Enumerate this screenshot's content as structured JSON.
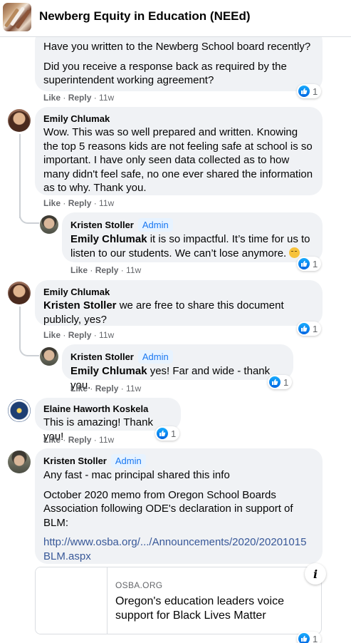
{
  "header": {
    "group_name": "Newberg Equity in Education (NEEd)"
  },
  "common": {
    "like": "Like",
    "reply": "Reply",
    "sep": " · ",
    "admin": "Admin"
  },
  "c1": {
    "para1": "Have you written to the Newberg School board recently?",
    "para2": "Did you receive a response back as required by the superintendent working agreement?",
    "time": "11w",
    "reactions": "1"
  },
  "c2": {
    "author": "Emily Chlumak",
    "text": "Wow. This was so well prepared and written. Knowing the top 5 reasons kids are not feeling safe at school is so important. I have only seen data collected as to how many didn't feel safe, no one ever shared the information as to why. Thank you.",
    "time": "11w"
  },
  "r1": {
    "author": "Kristen Stoller",
    "mention": "Emily Chlumak",
    "text": " it is so impactful. It’s time for us to listen to our students. We can’t lose anymore. ",
    "emoji": "disappointed-face",
    "time": "11w",
    "reactions": "1"
  },
  "c3": {
    "author": "Emily Chlumak",
    "mention": "Kristen Stoller",
    "text": " we are free to share this document publicly, yes?",
    "time": "11w",
    "reactions": "1"
  },
  "r2": {
    "author": "Kristen Stoller",
    "mention": "Emily Chlumak",
    "text": " yes! Far and wide - thank you.",
    "time": "11w",
    "reactions": "1"
  },
  "c4": {
    "author": "Elaine Haworth Koskela",
    "text": "This is amazing! Thank you!",
    "time": "11w",
    "reactions": "1"
  },
  "c5": {
    "author": "Kristen Stoller",
    "para1": "Any fast - mac principal shared this info",
    "para2": "October 2020 memo from Oregon School Boards Association following ODE's declaration in support of BLM:",
    "link": "http://www.osba.org/.../Announcements/2020/20201015 BLM.aspx",
    "reactions": "1"
  },
  "preview": {
    "domain": "OSBA.ORG",
    "title": "Oregon's education leaders voice support for Black Lives Matter",
    "info_glyph": "i"
  },
  "colors": {
    "like_blue": "#1877f2",
    "bubble": "#f0f2f5",
    "meta_gray": "#65676b"
  }
}
